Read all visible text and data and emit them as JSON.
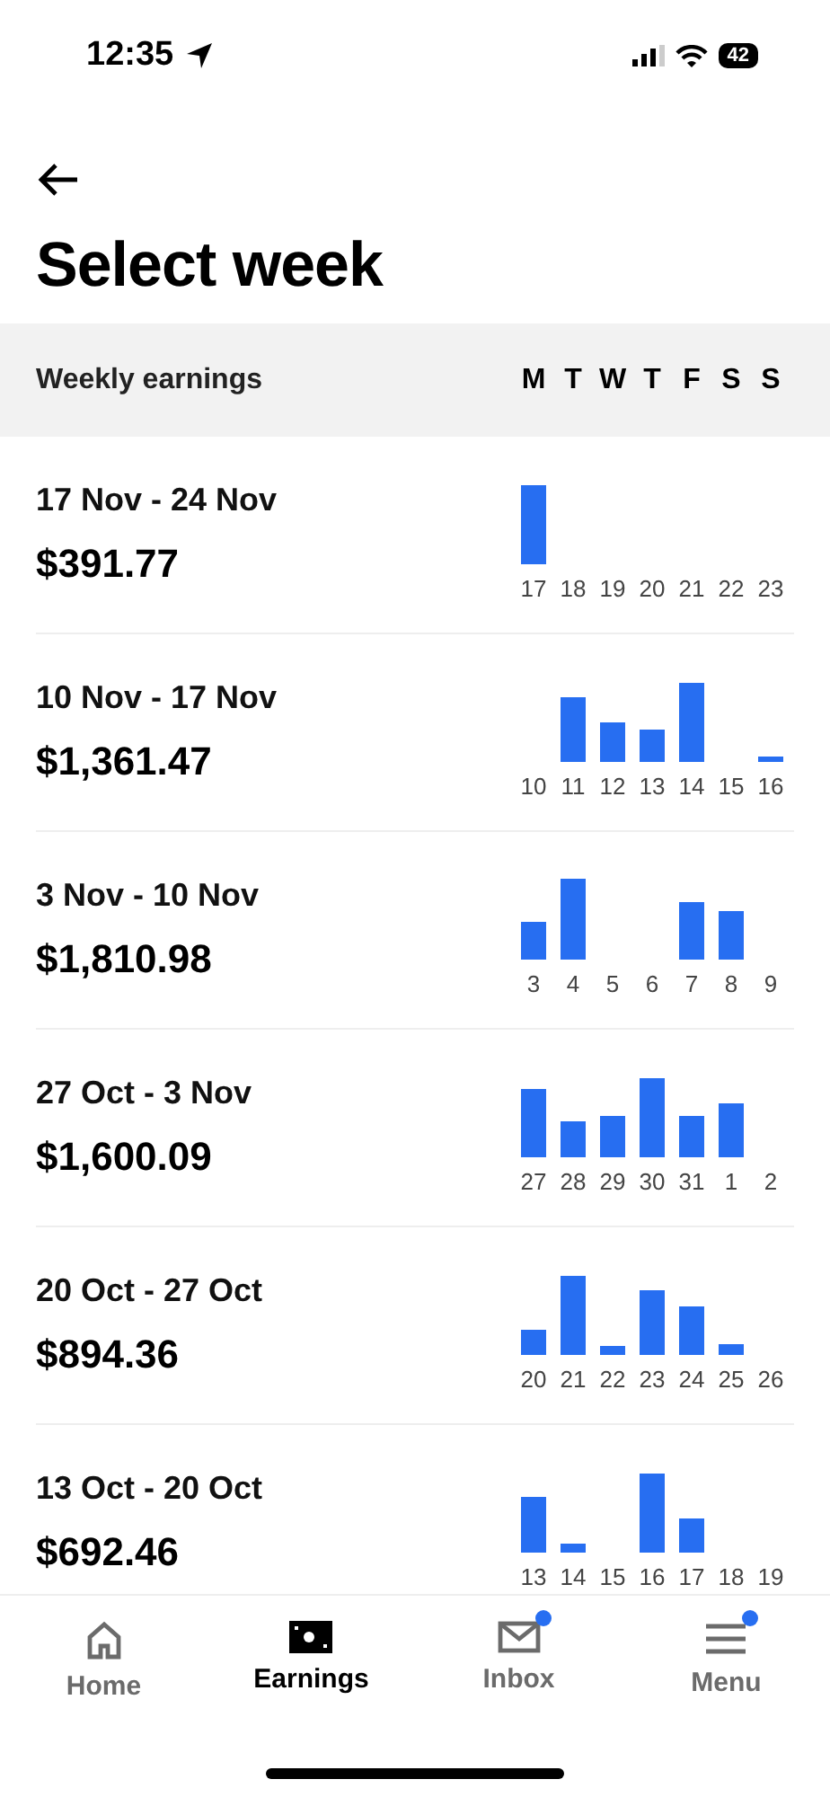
{
  "status_bar": {
    "time": "12:35",
    "battery": "42"
  },
  "title": "Select week",
  "header": {
    "label": "Weekly earnings",
    "days": [
      "M",
      "T",
      "W",
      "T",
      "F",
      "S",
      "S"
    ]
  },
  "weeks": [
    {
      "range": "17 Nov - 24 Nov",
      "amount": "$391.77",
      "dates": [
        "17",
        "18",
        "19",
        "20",
        "21",
        "22",
        "23"
      ]
    },
    {
      "range": "10 Nov - 17 Nov",
      "amount": "$1,361.47",
      "dates": [
        "10",
        "11",
        "12",
        "13",
        "14",
        "15",
        "16"
      ]
    },
    {
      "range": "3 Nov - 10 Nov",
      "amount": "$1,810.98",
      "dates": [
        "3",
        "4",
        "5",
        "6",
        "7",
        "8",
        "9"
      ]
    },
    {
      "range": "27 Oct - 3 Nov",
      "amount": "$1,600.09",
      "dates": [
        "27",
        "28",
        "29",
        "30",
        "31",
        "1",
        "2"
      ]
    },
    {
      "range": "20 Oct - 27 Oct",
      "amount": "$894.36",
      "dates": [
        "20",
        "21",
        "22",
        "23",
        "24",
        "25",
        "26"
      ]
    },
    {
      "range": "13 Oct - 20 Oct",
      "amount": "$692.46",
      "dates": [
        "13",
        "14",
        "15",
        "16",
        "17",
        "18",
        "19"
      ]
    }
  ],
  "tab_bar": [
    {
      "kind": "home",
      "label": "Home",
      "selected": false,
      "badge": false
    },
    {
      "kind": "earnings",
      "label": "Earnings",
      "selected": true,
      "badge": false
    },
    {
      "kind": "inbox",
      "label": "Inbox",
      "selected": false,
      "badge": true
    },
    {
      "kind": "menu",
      "label": "Menu",
      "selected": false,
      "badge": true
    }
  ]
}
